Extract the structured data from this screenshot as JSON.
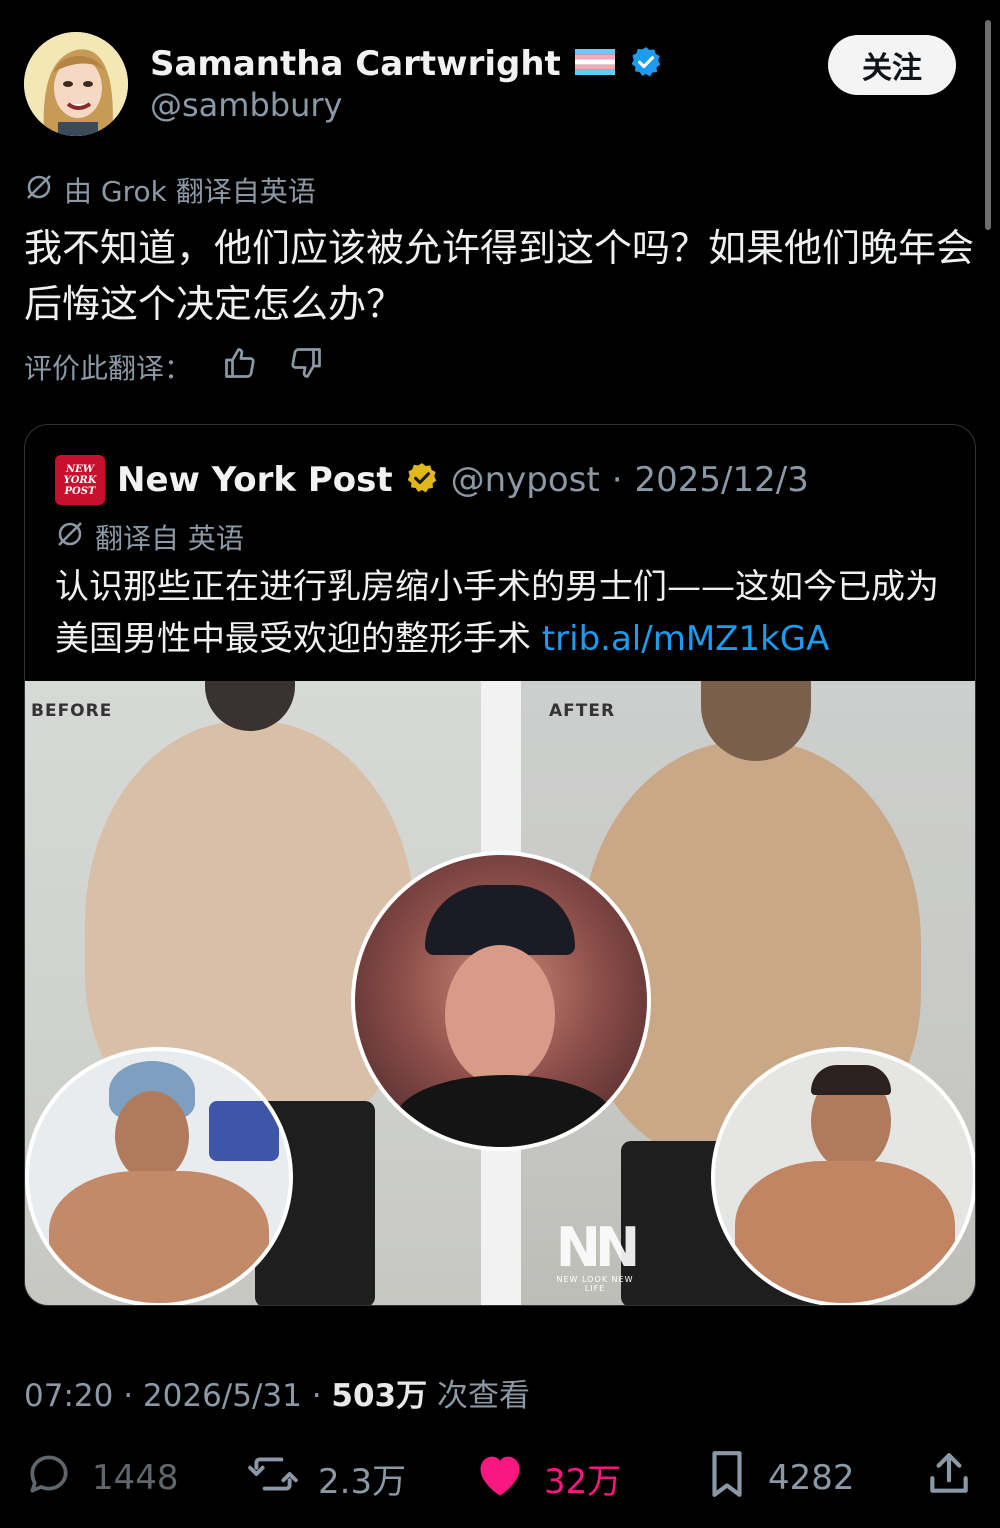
{
  "author": {
    "name": "Samantha Cartwright",
    "flag_icon": "trans-flag-icon",
    "verified_icon": "verified-badge-icon",
    "handle": "@sambbury",
    "follow_label": "关注"
  },
  "post": {
    "translated_note": "由 Grok 翻译自英语",
    "text": "我不知道，他们应该被允许得到这个吗？如果他们晚年会后悔这个决定怎么办？",
    "rate_label": "评价此翻译："
  },
  "quote": {
    "name": "New York Post",
    "logo_text": "NEW YORK POST",
    "handle": "@nypost",
    "sep": "·",
    "date": "2025/12/3",
    "translated_note": "翻译自 英语",
    "text": "认识那些正在进行乳房缩小手术的男士们——这如今已成为美国男性中最受欢迎的整形手术 ",
    "link": "trib.al/mMZ1kGA",
    "image": {
      "before_label": "BEFORE",
      "after_label": "AFTER",
      "watermark": "NN",
      "watermark_sub": "NEW LOOK NEW LIFE"
    }
  },
  "meta": {
    "time": "07:20",
    "sep1": " · ",
    "date": "2026/5/31",
    "sep2": " · ",
    "views": "503万",
    "views_suffix": " 次查看"
  },
  "actions": {
    "replies": "1448",
    "reposts": "2.3万",
    "likes": "32万",
    "bookmarks": "4282"
  },
  "colors": {
    "background": "#000000",
    "link": "#1d9bf0",
    "like": "#f91880",
    "muted": "#8b98a5",
    "verified_blue": "#1d9bf0",
    "verified_gold": "#e2b719"
  }
}
